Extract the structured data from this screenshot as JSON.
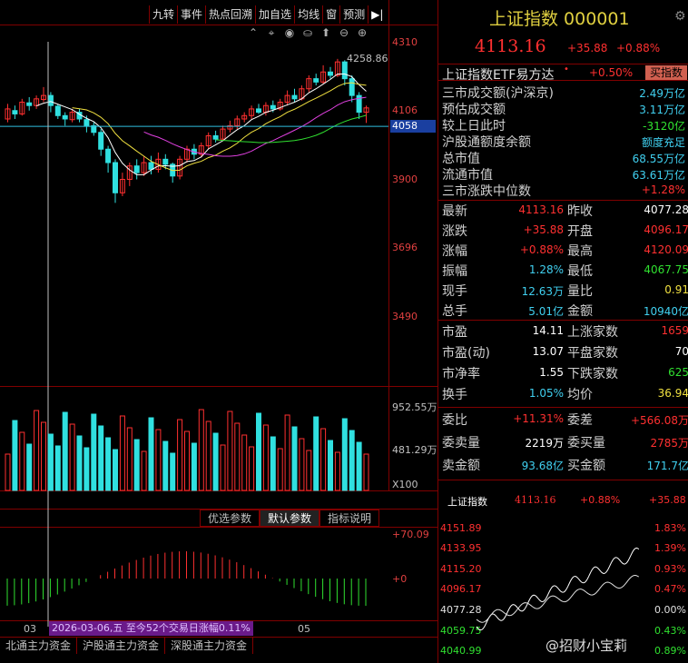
{
  "toolbar": {
    "items": [
      "九转",
      "事件",
      "热点回溯",
      "加自选",
      "均线",
      "窗",
      "预测"
    ],
    "arrow": "▶|"
  },
  "chart_icons": [
    "⌃",
    "⌖",
    "◉",
    "⛀",
    "⬆",
    "⊖",
    "⊕"
  ],
  "price_axis": {
    "labels": [
      "4310",
      "4106",
      "3900",
      "3696",
      "3490"
    ],
    "current": "4058",
    "peak_label": "4258.86"
  },
  "volume_axis": {
    "labels": [
      "952.55万",
      "481.29万",
      "X100"
    ]
  },
  "indicator_tabs": [
    "优选参数",
    "默认参数",
    "指标说明"
  ],
  "macd_axis": {
    "labels": [
      "+70.09",
      "+0"
    ]
  },
  "date_info": "2026-03-06,五 至今52个交易日涨幅0.11%",
  "x_ticks": [
    "03",
    "05"
  ],
  "bottom_tabs": [
    "北通主力资金",
    "沪股通主力资金",
    "深股通主力资金"
  ],
  "header": {
    "title": "上证指数 000001",
    "price": "4113.16",
    "change": "+35.88",
    "change_pct": "+0.88%"
  },
  "etf": {
    "name": "上证指数ETF易方达",
    "dot": "•",
    "pct": "+0.50%",
    "button": "买指数"
  },
  "stats": [
    {
      "label": "三市成交额(沪深京)",
      "value": "2.49万亿",
      "color": "cyan"
    },
    {
      "label": "预估成交额",
      "value": "3.11万亿",
      "color": "cyan"
    },
    {
      "label": "较上日此时",
      "value": "-3120亿",
      "color": "green"
    },
    {
      "label": "沪股通额度余额",
      "value": "额度充足",
      "color": "cyan"
    },
    {
      "label": "总市值",
      "value": "68.55万亿",
      "color": "cyan"
    },
    {
      "label": "流通市值",
      "value": "63.61万亿",
      "color": "cyan"
    },
    {
      "label": "三市涨跌中位数",
      "value": "+1.28%",
      "color": "red"
    }
  ],
  "quote": [
    {
      "l1": "最新",
      "v1": "4113.16",
      "c1": "red",
      "l2": "昨收",
      "v2": "4077.28",
      "c2": "white"
    },
    {
      "l1": "涨跌",
      "v1": "+35.88",
      "c1": "red",
      "l2": "开盘",
      "v2": "4096.17",
      "c2": "red"
    },
    {
      "l1": "涨幅",
      "v1": "+0.88%",
      "c1": "red",
      "l2": "最高",
      "v2": "4120.09",
      "c2": "red"
    },
    {
      "l1": "振幅",
      "v1": "1.28%",
      "c1": "cyan",
      "l2": "最低",
      "v2": "4067.75",
      "c2": "green"
    },
    {
      "l1": "现手",
      "v1": "12.63万",
      "c1": "cyan",
      "l2": "量比",
      "v2": "0.91",
      "c2": "yellow"
    },
    {
      "l1": "总手",
      "v1": "5.01亿",
      "c1": "cyan",
      "l2": "金额",
      "v2": "10940亿",
      "c2": "cyan"
    }
  ],
  "market": [
    {
      "l1": "市盈",
      "v1": "14.11",
      "c1": "white",
      "l2": "上涨家数",
      "v2": "1659",
      "c2": "red"
    },
    {
      "l1": "市盈(动)",
      "v1": "13.07",
      "c1": "white",
      "l2": "平盘家数",
      "v2": "70",
      "c2": "white"
    },
    {
      "l1": "市净率",
      "v1": "1.55",
      "c1": "white",
      "l2": "下跌家数",
      "v2": "625",
      "c2": "green"
    },
    {
      "l1": "换手",
      "v1": "1.05%",
      "c1": "cyan",
      "l2": "均价",
      "v2": "36.94",
      "c2": "yellow"
    }
  ],
  "orders": [
    {
      "l1": "委比",
      "v1": "+11.31%",
      "c1": "red",
      "l2": "委差",
      "v2": "+566.08万",
      "c2": "red"
    },
    {
      "l1": "委卖量",
      "v1": "2219万",
      "c1": "white",
      "l2": "委买量",
      "v2": "2785万",
      "c2": "red"
    },
    {
      "l1": "卖金额",
      "v1": "93.68亿",
      "c1": "cyan",
      "l2": "买金额",
      "v2": "171.7亿",
      "c2": "cyan"
    }
  ],
  "mini": {
    "name": "上证指数",
    "price": "4113.16",
    "pct": "+0.88%",
    "chg": "+35.88",
    "left_labels": [
      "4151.89",
      "4133.95",
      "4115.20",
      "4096.17",
      "4077.28",
      "4059.75",
      "4040.99"
    ],
    "right_labels": [
      "1.83%",
      "1.39%",
      "0.93%",
      "0.47%",
      "0.00%",
      "0.43%",
      "0.89%"
    ]
  },
  "watermark": "@招财小宝莉",
  "colors": {
    "up": "#ff3030",
    "down": "#30e0e0",
    "grid": "#800000",
    "accent": "#e0d040"
  }
}
